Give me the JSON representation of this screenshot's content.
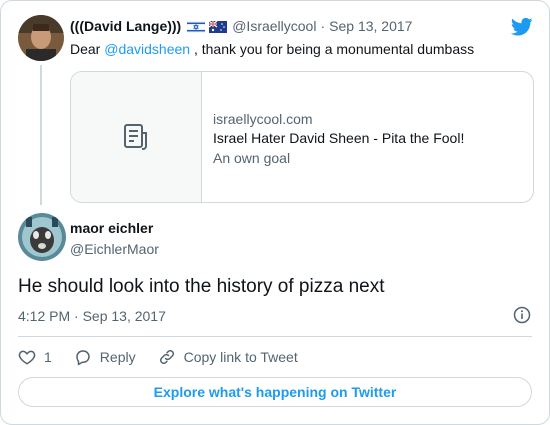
{
  "quoted_tweet": {
    "display_name": "(((David Lange)))",
    "flags": [
      "israel-flag-icon",
      "australia-flag-icon"
    ],
    "handle": "@Israellycool",
    "separator": "·",
    "date": "Sep 13, 2017",
    "text_prefix": "Dear ",
    "mention": "@davidsheen",
    "text_suffix": " , thank you for being a monumental dumbass",
    "link_card": {
      "domain": "israellycool.com",
      "title": "Israel Hater David Sheen - Pita the Fool!",
      "description": "An own goal"
    }
  },
  "reply_tweet": {
    "display_name": "maor eichler",
    "handle": "@EichlerMaor",
    "text": "He should look into the history of pizza next",
    "timestamp": "4:12 PM · Sep 13, 2017"
  },
  "actions": {
    "like_count": "1",
    "reply_label": "Reply",
    "copy_label": "Copy link to Tweet"
  },
  "footer": {
    "explore_label": "Explore what's happening on Twitter"
  },
  "colors": {
    "accent": "#1d9bf0",
    "muted": "#536471",
    "border": "#cfd9de"
  }
}
